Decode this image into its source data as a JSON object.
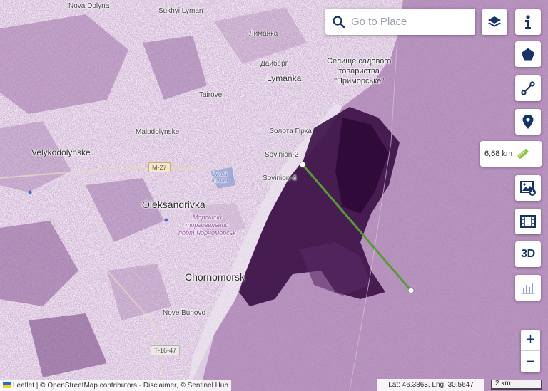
{
  "places": {
    "nova_dolyna": "Nova Dolyna",
    "sukhyi_lyman": "Sukhyi Lyman",
    "lymanka_cyr": "Лиманка",
    "daiberh": "Дайберг",
    "lymanka": "Lymanka",
    "tairove": "Tairove",
    "selyshche": "Селище садового\nтовариства\n\"Приморське\"",
    "malodolynske": "Malodolynske",
    "zolota_hirka": "Золота Гірка",
    "velykodolynske": "Velykodolynske",
    "sovinion2": "Sovinion-2",
    "sovinion4": "Sovinion-4",
    "sukhyi_lyman_water": "Сухий\nлиман",
    "oleksandrivka": "Oleksandrivka",
    "port": "Морський\nторговельний\nпорт Чорноморськ",
    "chornomorsk": "Chornomorsk",
    "nove_buhovo": "Nove Buhovo"
  },
  "roads": {
    "m27": "M-27",
    "t1647": "T-16-47"
  },
  "search": {
    "placeholder": "Go to Place"
  },
  "measure": {
    "distance": "6,68 km"
  },
  "controls": {
    "layers": "layers-icon",
    "info": "info-icon",
    "polygon": "polygon-icon",
    "line": "polyline-icon",
    "marker": "marker-icon",
    "image_download": "image-download-icon",
    "film": "film-icon",
    "three_d_label": "3D",
    "histogram": "histogram-icon",
    "zoom_in": "+",
    "zoom_out": "−"
  },
  "attribution": {
    "text": "Leaflet | © OpenStreetMap contributors - Disclaimer, © Sentinel Hub"
  },
  "coordinates": {
    "text": "Lat: 46.3863, Lng: 30.5647"
  },
  "scale": {
    "label": "2 km"
  },
  "colors": {
    "accent": "#16316b",
    "measure_line": "#5a9a36",
    "oil_slick": "#3a0f45",
    "radar_texture": "#7b3f86"
  }
}
